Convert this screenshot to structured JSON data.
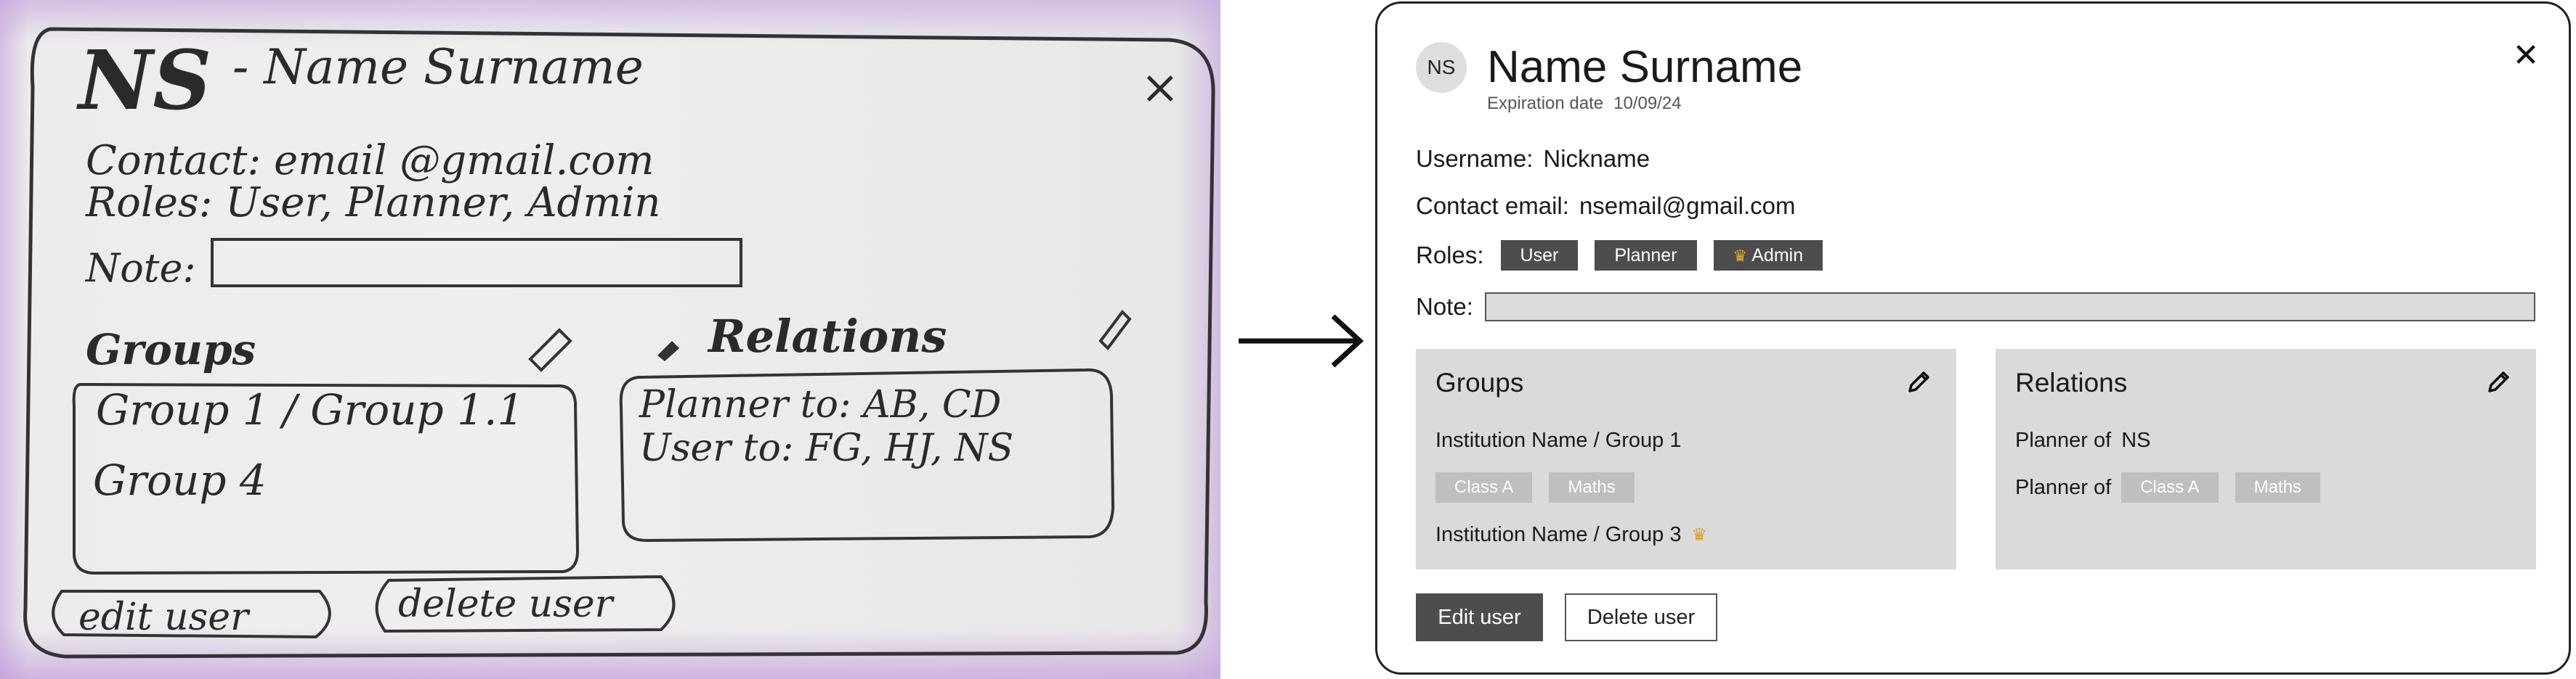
{
  "sketch": {
    "initials": "NS",
    "name": "- Name Surname",
    "contact": "Contact: email @gmail.com",
    "roles": "Roles: User, Planner, Admin",
    "note_label": "Note:",
    "groups_title": "Groups",
    "relations_title": "Relations",
    "group_line1": "Group 1 / Group 1.1",
    "group_line2": "Group 4",
    "relation_line1": "Planner to: AB, CD",
    "relation_line2": "User to: FG, HJ, NS",
    "edit_button": "edit user",
    "delete_button": "delete user",
    "close_glyph": "×"
  },
  "dialog": {
    "avatar_initials": "NS",
    "name": "Name Surname",
    "expiration_label": "Expiration date",
    "expiration_value": "10/09/24",
    "close_glyph": "✕",
    "username_label": "Username:",
    "username_value": "Nickname",
    "email_label": "Contact email:",
    "email_value": "nsemail@gmail.com",
    "roles_label": "Roles:",
    "roles": [
      "User",
      "Planner",
      "Admin"
    ],
    "admin_icon": "crown-icon",
    "note_label": "Note:",
    "note_value": "",
    "groups": {
      "title": "Groups",
      "edit_icon": "pencil-icon",
      "items": [
        {
          "name": "Institution Name / Group 1",
          "chips": [
            "Class A",
            "Maths"
          ]
        },
        {
          "name": "Institution Name / Group 3",
          "icon": "crown-icon"
        }
      ]
    },
    "relations": {
      "title": "Relations",
      "edit_icon": "pencil-icon",
      "items": [
        {
          "label": "Planner of",
          "value": "NS"
        },
        {
          "label": "Planner of",
          "chips": [
            "Class A",
            "Maths"
          ]
        }
      ]
    },
    "buttons": {
      "edit": "Edit user",
      "delete": "Delete user"
    }
  },
  "colors": {
    "dark_tag": "#4d4d4d",
    "panel_bg": "#dadada",
    "chip_bg": "#bfbfbf",
    "note_bg": "#dcdcdc",
    "crown": "#d8a020"
  }
}
